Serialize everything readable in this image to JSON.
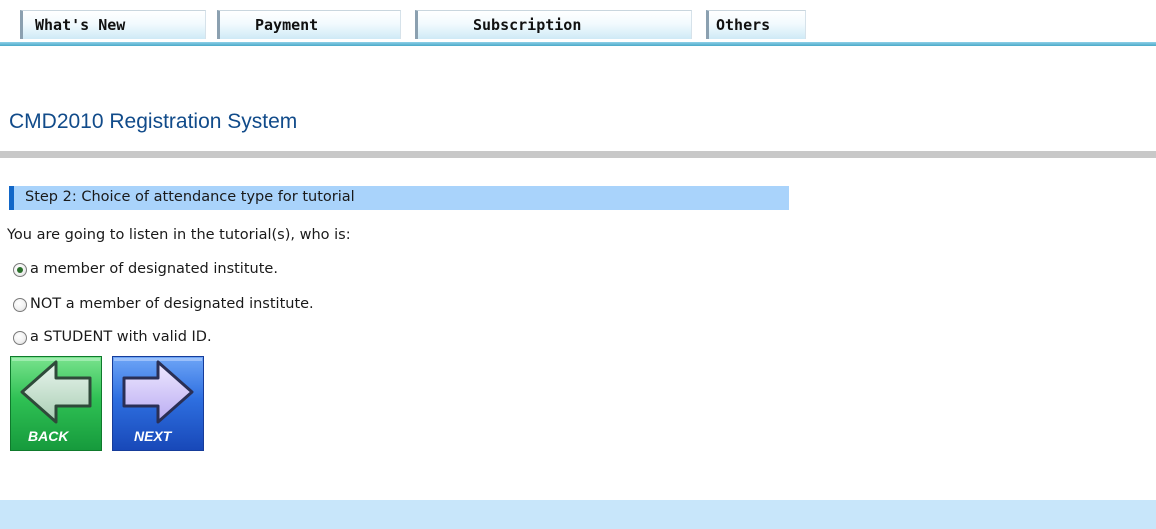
{
  "tabs": [
    {
      "label": "What's New"
    },
    {
      "label": "Payment"
    },
    {
      "label": "Subscription"
    },
    {
      "label": "Others"
    }
  ],
  "page_title": "CMD2010 Registration System",
  "step": {
    "label": "Step 2: Choice of attendance type for tutorial"
  },
  "question": "You are going to listen in the tutorial(s), who is:",
  "options": [
    {
      "label": "a member of designated institute.",
      "selected": true
    },
    {
      "label": "NOT a member of designated institute.",
      "selected": false
    },
    {
      "label": "a STUDENT with valid ID.",
      "selected": false
    }
  ],
  "buttons": {
    "back_label": "BACK",
    "next_label": "NEXT"
  },
  "colors": {
    "tab_line": "#4ba9c8",
    "title": "#114b8a",
    "step_bar": "#a9d3fb",
    "step_accent": "#1267c8",
    "back_button": "#22b14c",
    "next_button": "#1f5fd6",
    "footer": "#c8e6fa"
  },
  "icons": {
    "back": "left-arrow-icon",
    "next": "right-arrow-icon"
  }
}
